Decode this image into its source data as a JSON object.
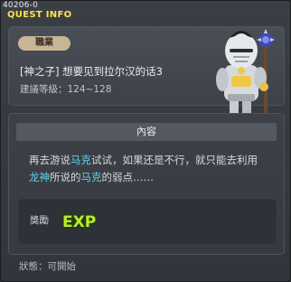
{
  "window": {
    "quest_id": "40206-0",
    "title": "QUEST INFO"
  },
  "quest": {
    "job_badge": "職業",
    "name": "[神之子] 想要见到拉尔汉的话3",
    "level_label": "建議等級：",
    "level_range": "124~128"
  },
  "content": {
    "header": "內容",
    "desc_parts": [
      "再去游说",
      "马克",
      "试试，如果还是不行，就只能去利用",
      "龙神",
      "所说的",
      "马克",
      "的弱点……"
    ],
    "reward_label": "獎勵",
    "reward_icon": "exp-icon",
    "reward_text": "EXP"
  },
  "status": {
    "label": "狀態：",
    "value": "可開始"
  },
  "colors": {
    "title": "#ffe24a",
    "highlight": "#5fd6ec",
    "badge": "#c8b596",
    "exp": "#b4f02a"
  }
}
